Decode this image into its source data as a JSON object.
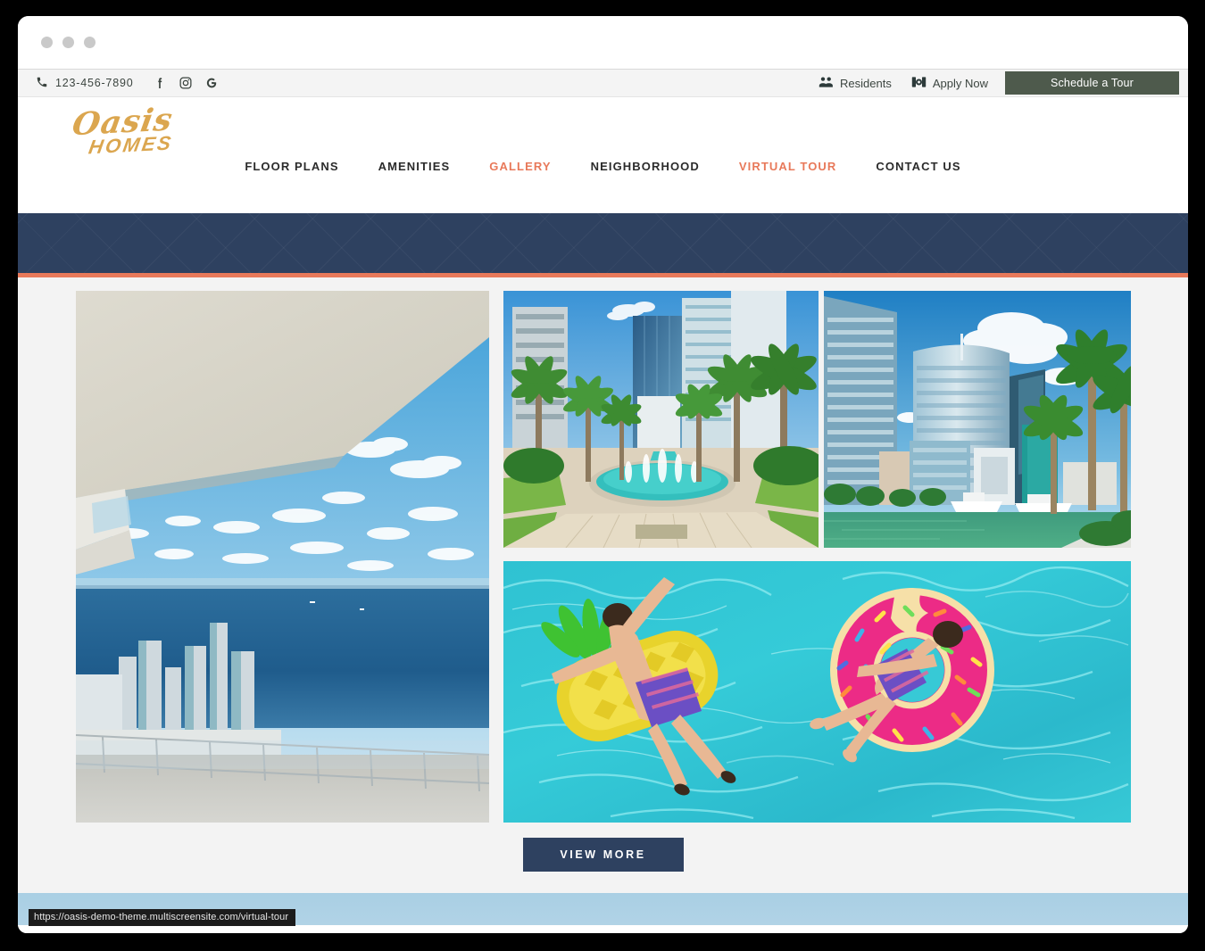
{
  "browser": {
    "traffic_lights": [
      "close",
      "minimize",
      "maximize"
    ],
    "status_url": "https://oasis-demo-theme.multiscreensite.com/virtual-tour"
  },
  "utility_bar": {
    "phone": "123-456-7890",
    "phone_icon": "phone-icon",
    "social": [
      {
        "name": "facebook-icon",
        "label": "f"
      },
      {
        "name": "instagram-icon",
        "label": "Instagram"
      },
      {
        "name": "google-icon",
        "label": "G"
      }
    ],
    "residents_label": "Residents",
    "residents_icon": "users-icon",
    "apply_label": "Apply Now",
    "apply_icon": "application-icon",
    "schedule_label": "Schedule a Tour"
  },
  "brand": {
    "logo_script": "Oasis",
    "logo_word": "HOMES",
    "logo_color": "#dba64f"
  },
  "nav": {
    "items": [
      {
        "label": "FLOOR PLANS",
        "active": false
      },
      {
        "label": "AMENITIES",
        "active": false
      },
      {
        "label": "GALLERY",
        "active": true
      },
      {
        "label": "NEIGHBORHOOD",
        "active": false
      },
      {
        "label": "VIRTUAL TOUR",
        "active": true
      },
      {
        "label": "CONTACT US",
        "active": false
      }
    ],
    "accent_color": "#e8795a",
    "text_color": "#2b2b2b"
  },
  "hero_band": {
    "background_color": "#2e4160",
    "accent_border_color": "#e8795a",
    "pattern": "diagonal-diamond-lattice"
  },
  "gallery": {
    "background_color": "#f3f3f3",
    "tiles": [
      {
        "name": "gallery-image-balcony-ocean-view",
        "alt": "Balcony with ocean and city skyline view"
      },
      {
        "name": "gallery-image-palm-fountain-plaza",
        "alt": "Palm tree lined plaza with fountain"
      },
      {
        "name": "gallery-image-miami-waterfront-skyline",
        "alt": "Miami waterfront skyline with yachts and palms"
      },
      {
        "name": "gallery-image-pool-floats",
        "alt": "Two boys floating on pineapple and donut pool floats"
      }
    ],
    "view_more_label": "VIEW MORE",
    "view_more_color": "#2e4160"
  },
  "next_section": {
    "background_color": "#aed0e5"
  }
}
